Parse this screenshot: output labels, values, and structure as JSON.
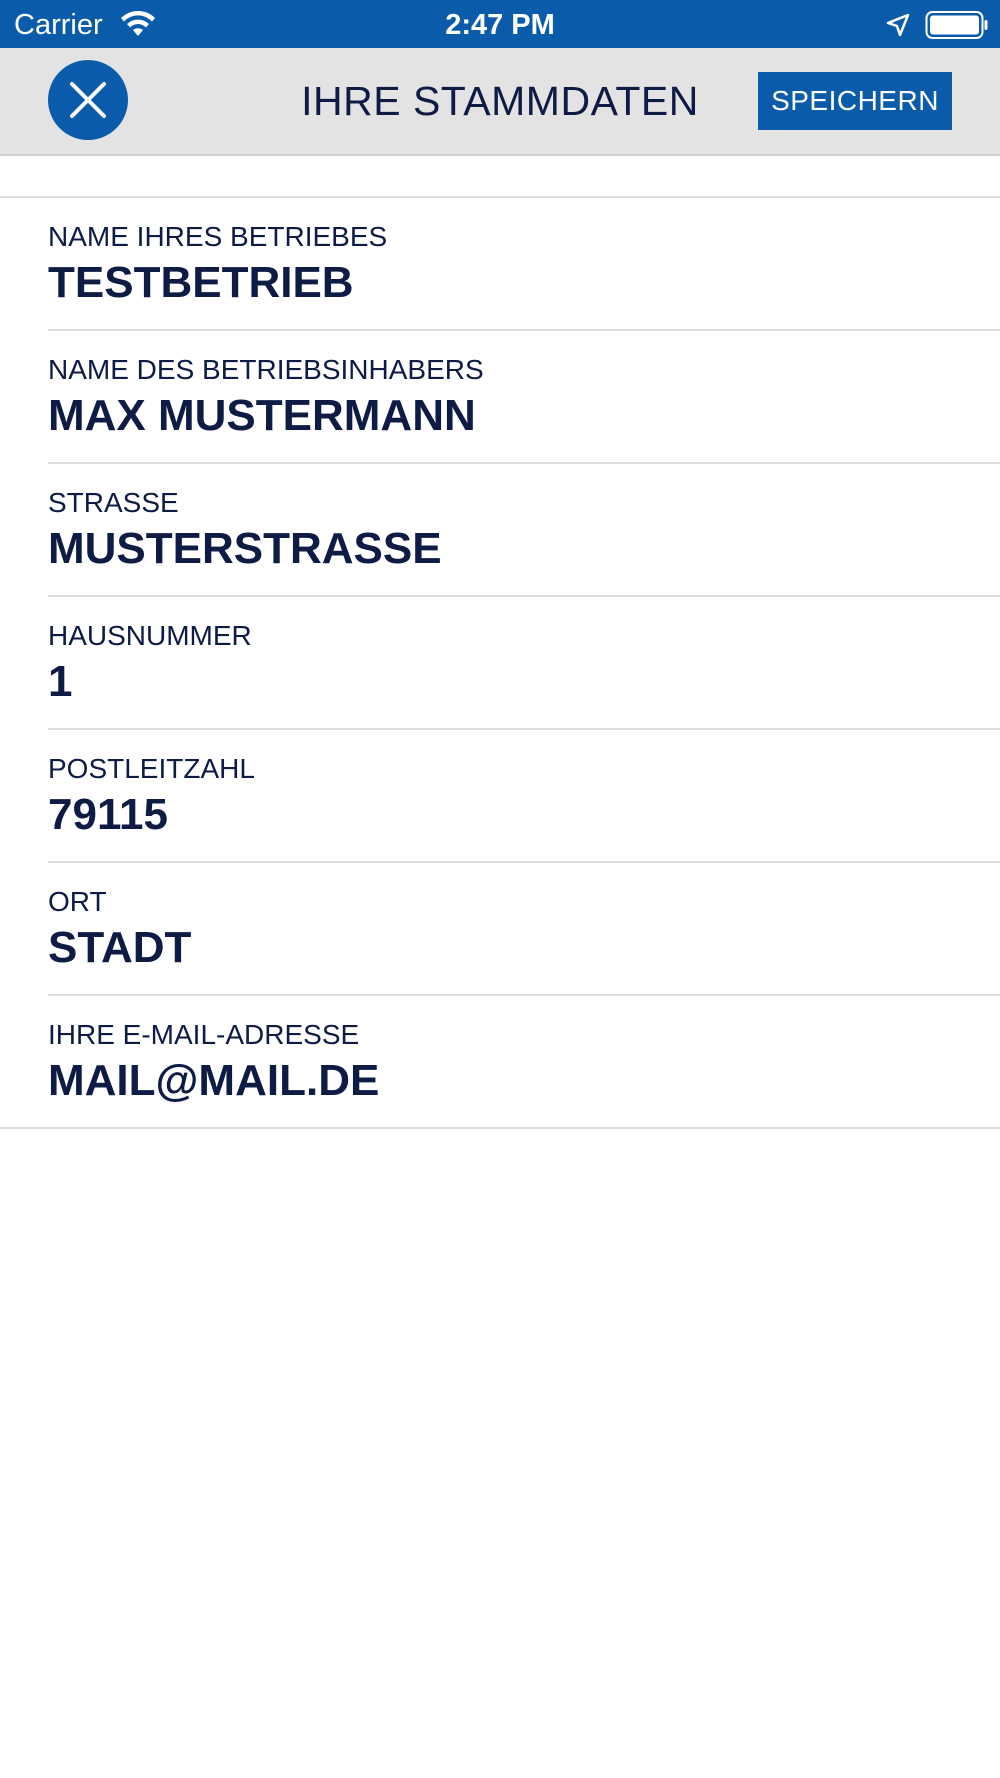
{
  "status_bar": {
    "carrier": "Carrier",
    "time": "2:47 PM"
  },
  "nav": {
    "title": "IHRE STAMMDATEN",
    "save_label": "SPEICHERN"
  },
  "fields": [
    {
      "label": "NAME IHRES BETRIEBES",
      "value": "TESTBETRIEB"
    },
    {
      "label": "NAME DES BETRIEBSINHABERS",
      "value": "MAX MUSTERMANN"
    },
    {
      "label": "STRASSE",
      "value": "MUSTERSTRASSE"
    },
    {
      "label": "HAUSNUMMER",
      "value": "1"
    },
    {
      "label": "POSTLEITZAHL",
      "value": "79115"
    },
    {
      "label": "ORT",
      "value": "STADT"
    },
    {
      "label": "IHRE E-MAIL-ADRESSE",
      "value": "MAIL@MAIL.DE"
    }
  ],
  "colors": {
    "primary": "#0a5cab",
    "text": "#0d1b45",
    "nav_background": "#e3e3e3",
    "divider": "#dedede"
  },
  "icons": {
    "status_wifi": "wifi-icon",
    "status_location": "location-arrow-icon",
    "status_battery": "battery-icon",
    "close": "close-icon"
  }
}
